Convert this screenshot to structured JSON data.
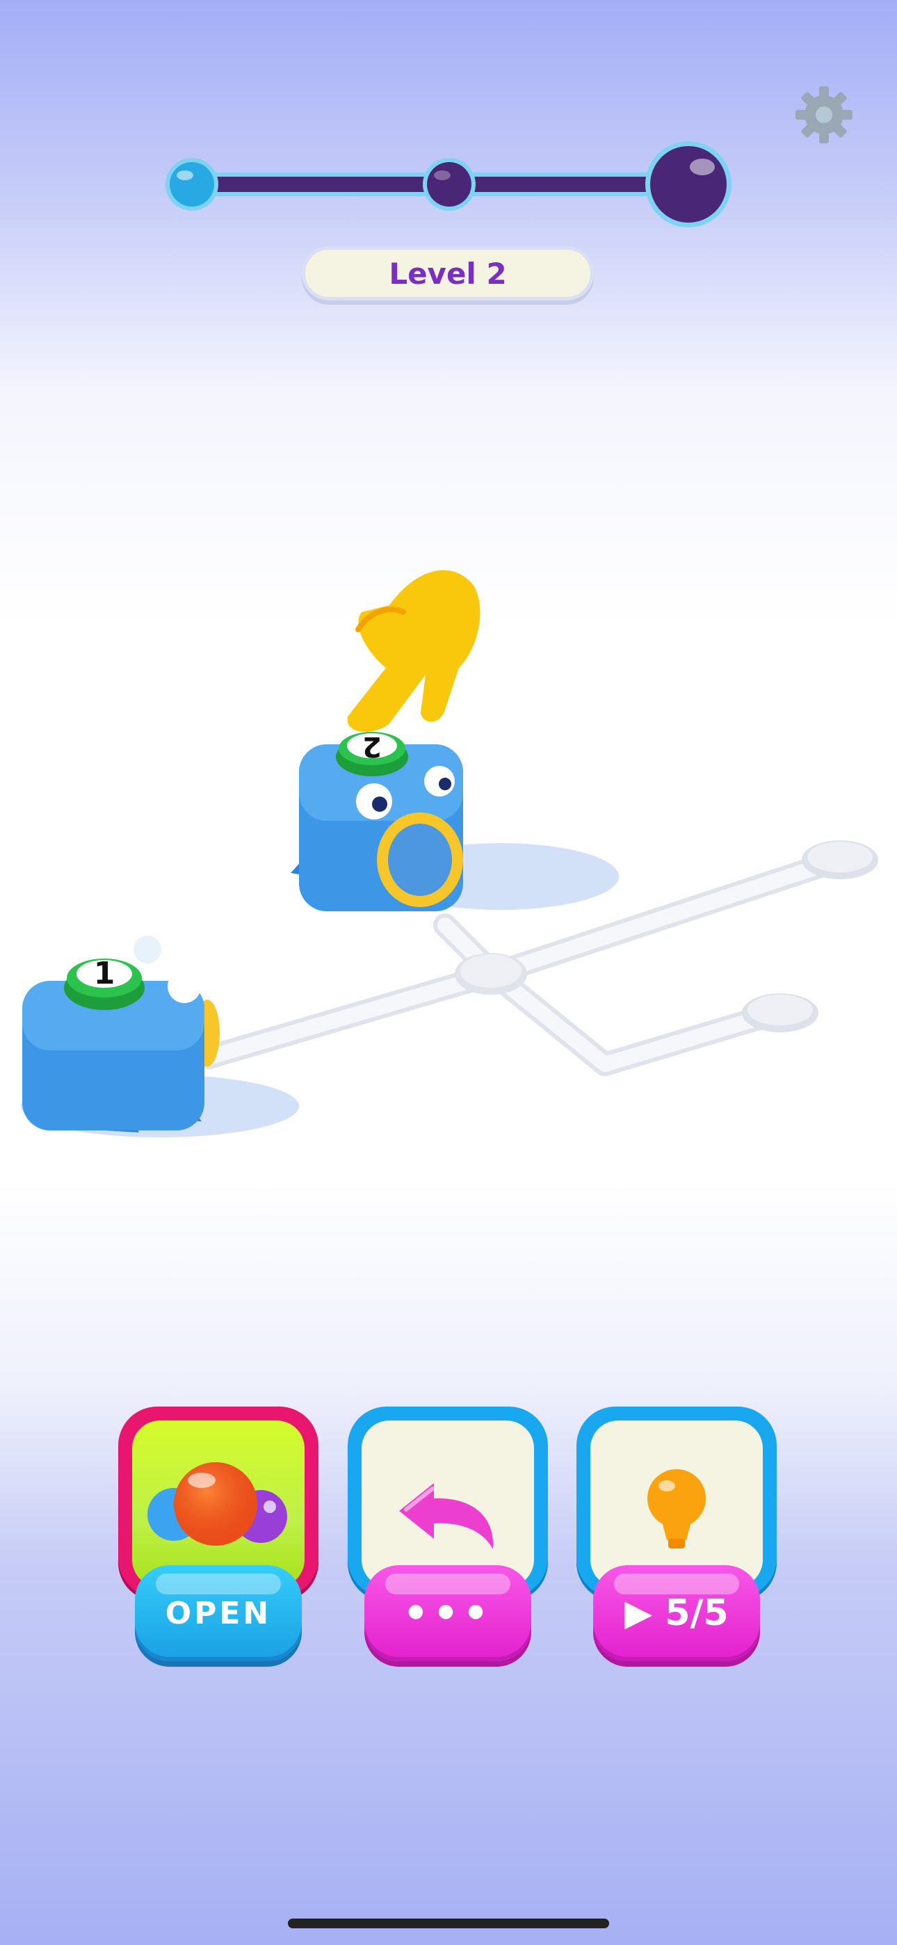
{
  "level": {
    "label": "Level 2"
  },
  "progress": {
    "stages": 3,
    "current_stage": 1
  },
  "pieces": [
    {
      "number": "1",
      "color": "blue"
    },
    {
      "number": "2",
      "color": "blue"
    }
  ],
  "buttons": {
    "open": {
      "label": "OPEN",
      "icon": "bubbles-icon"
    },
    "undo": {
      "label": "•••",
      "icon": "undo-arrow-icon"
    },
    "hint": {
      "label": "▶ 5/5",
      "icon": "lightbulb-icon"
    }
  },
  "colors": {
    "accent_purple": "#7b2fc2",
    "tile_pink": "#e8166f",
    "tile_blue": "#19a8ef",
    "pill_magenta": "#e221cd",
    "pill_cyan": "#1a9fe4"
  }
}
